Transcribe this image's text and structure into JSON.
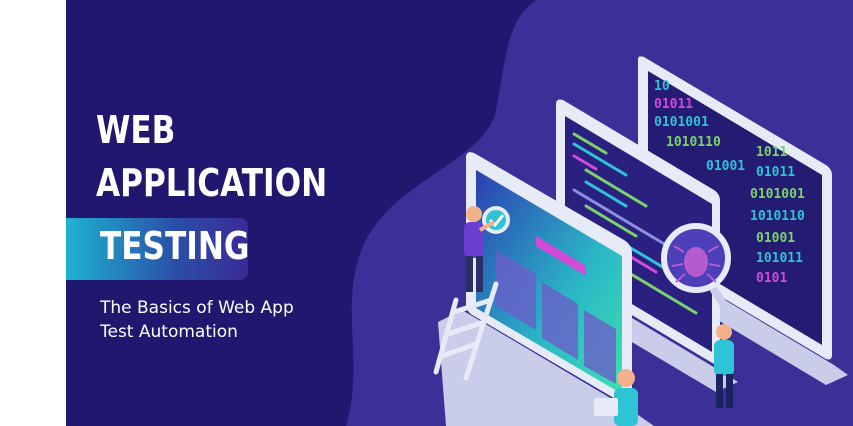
{
  "banner": {
    "title_line1": "WEB",
    "title_line2": "APPLICATION",
    "title_line3": "TESTING",
    "subtitle_line1": "The Basics of Web App",
    "subtitle_line2": "Test Automation",
    "binary_rows": [
      "10",
      "01011",
      "0101001",
      "1010110",
      "01001",
      "101011",
      "0101001",
      "1011",
      "0101"
    ],
    "colors": {
      "background": "#21176e",
      "blob": "#3b2f98",
      "accent_cyan": "#2ec4d6",
      "accent_pink": "#d24bd8",
      "accent_green": "#7bd36a"
    }
  }
}
